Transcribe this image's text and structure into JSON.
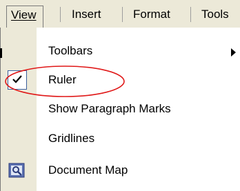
{
  "menubar": {
    "items": [
      {
        "label": "View",
        "open": true
      },
      {
        "label": "Insert"
      },
      {
        "label": "Format"
      },
      {
        "label": "Tools"
      }
    ]
  },
  "menu": {
    "items": [
      {
        "label": "Toolbars",
        "has_submenu": true
      },
      {
        "label": "Ruler",
        "checked": true,
        "highlighted": true
      },
      {
        "label": "Show Paragraph Marks"
      },
      {
        "label": "Gridlines"
      },
      {
        "label": "Document Map",
        "icon": "document-map-icon"
      }
    ]
  },
  "annotation": {
    "color": "#e01818"
  },
  "colors": {
    "menubar_bg": "#ece9d8",
    "check_border": "#3a5f9c"
  }
}
